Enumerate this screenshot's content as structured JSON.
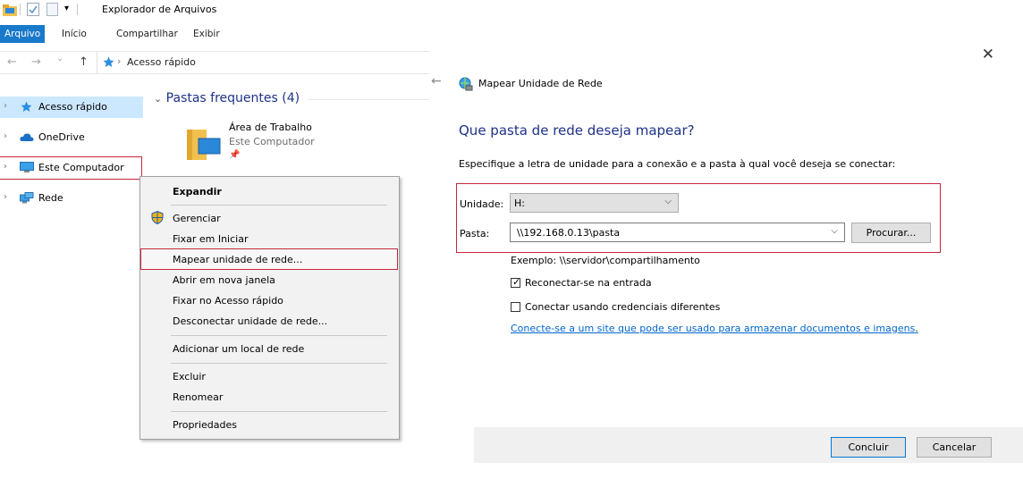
{
  "explorer": {
    "title": "Explorador de Arquivos",
    "ribbon_tabs": [
      "Arquivo",
      "Início",
      "Compartilhar",
      "Exibir"
    ],
    "address": {
      "back": "←",
      "forward": "→",
      "recent": "⌄",
      "up": "↑",
      "crumb_separator": "›",
      "crumb": "Acesso rápido"
    },
    "nav_items": [
      {
        "label": "Acesso rápido",
        "icon": "star-icon",
        "chevron": "›"
      },
      {
        "label": "OneDrive",
        "icon": "cloud-icon",
        "chevron": "›"
      },
      {
        "label": "Este Computador",
        "icon": "computer-icon",
        "chevron": "›"
      },
      {
        "label": "Rede",
        "icon": "network-icon",
        "chevron": "›"
      }
    ],
    "frequent_group": {
      "header": "Pastas frequentes (4)",
      "chevron": "⌄",
      "folder": {
        "name": "Área de Trabalho",
        "location": "Este Computador",
        "pin": "📌"
      }
    }
  },
  "context_menu": {
    "items": [
      {
        "label": "Expandir",
        "bold": true
      },
      {
        "label": "Gerenciar",
        "icon": "shield-icon"
      },
      {
        "label": "Fixar em Iniciar"
      },
      {
        "label": "Mapear unidade de rede...",
        "highlighted": true
      },
      {
        "label": "Abrir em nova janela"
      },
      {
        "label": "Fixar no Acesso rápido"
      },
      {
        "label": "Desconectar unidade de rede..."
      },
      {
        "label": "Adicionar um local de rede"
      },
      {
        "label": "Excluir"
      },
      {
        "label": "Renomear"
      },
      {
        "label": "Propriedades"
      }
    ]
  },
  "dialog": {
    "close": "✕",
    "back": "←",
    "title": "Mapear Unidade de Rede",
    "heading": "Que pasta de rede deseja mapear?",
    "description": "Especifique a letra de unidade para a conexão e a pasta à qual você deseja se conectar:",
    "drive_label": "Unidade:",
    "drive_value": "H:",
    "folder_label": "Pasta:",
    "folder_value": "\\\\192.168.0.13\\pasta",
    "dropdown_glyph": "⌵",
    "browse_button": "Procurar...",
    "example": "Exemplo: \\\\servidor\\compartilhamento",
    "reconnect_label": "Reconectar-se na entrada",
    "reconnect_checked": true,
    "check_mark": "✓",
    "credentials_label": "Conectar usando credenciais diferentes",
    "credentials_checked": false,
    "link_text": "Conecte-se a um site que pode ser usado para armazenar documentos e imagens",
    "link_suffix": ".",
    "ok_button": "Concluir",
    "cancel_button": "Cancelar"
  },
  "colors": {
    "accent": "#1979ca",
    "heading": "#1e3287",
    "highlight_border": "#c4263c",
    "selection": "#cce8ff",
    "link": "#0066cc"
  }
}
